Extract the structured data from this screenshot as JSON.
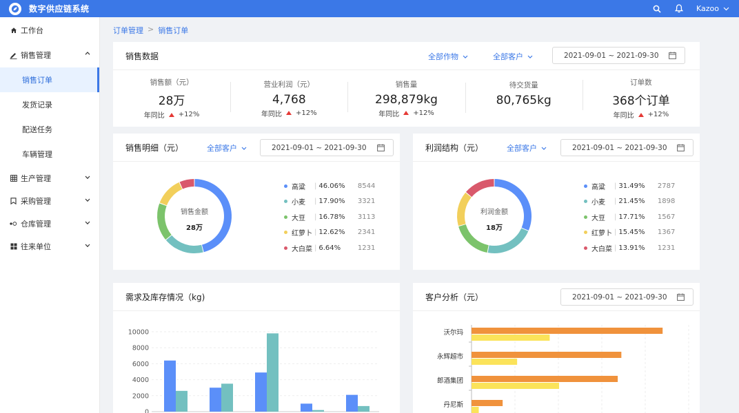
{
  "app": {
    "title": "数字供应链系统",
    "user": "Kazoo"
  },
  "sidebar": {
    "items": [
      {
        "label": "工作台",
        "icon": "home-icon"
      },
      {
        "label": "销售管理",
        "icon": "edit-icon",
        "expanded": true,
        "children": [
          "销售订单",
          "发货记录",
          "配送任务",
          "车辆管理"
        ],
        "active_child": "销售订单"
      },
      {
        "label": "生产管理",
        "icon": "grid-icon"
      },
      {
        "label": "采购管理",
        "icon": "bookmark-icon"
      },
      {
        "label": "仓库管理",
        "icon": "warehouse-icon"
      },
      {
        "label": "往来单位",
        "icon": "apps-icon"
      }
    ]
  },
  "breadcrumb": [
    "订单管理",
    "销售订单"
  ],
  "sales_data": {
    "title": "销售数据",
    "filter_crop": "全部作物",
    "filter_customer": "全部客户",
    "date_range": "2021-09-01 ~ 2021-09-30",
    "stats": [
      {
        "label": "销售额（元）",
        "value": "28万",
        "yoy_label": "年同比",
        "yoy": "+12%"
      },
      {
        "label": "营业利润（元）",
        "value": "4,768",
        "yoy_label": "年同比",
        "yoy": "+12%"
      },
      {
        "label": "销售量",
        "value": "298,879kg",
        "yoy_label": "年同比",
        "yoy": "+12%"
      },
      {
        "label": "待交货量",
        "value": "80,765kg"
      },
      {
        "label": "订单数",
        "value": "368个订单",
        "yoy_label": "年同比",
        "yoy": "+12%"
      }
    ]
  },
  "sales_detail": {
    "title": "销售明细（元）",
    "filter_customer": "全部客户",
    "date_range": "2021-09-01 ~ 2021-09-30",
    "center_label": "销售金额",
    "center_value": "28万"
  },
  "profit_structure": {
    "title": "利润结构（元）",
    "filter_customer": "全部客户",
    "date_range": "2021-09-01 ~ 2021-09-30",
    "center_label": "利润金额",
    "center_value": "18万"
  },
  "demand_inventory": {
    "title": "需求及库存情况（kg)"
  },
  "customer_analysis": {
    "title": "客户分析（元）",
    "date_range": "2021-09-01 ~ 2021-09-30"
  },
  "colors": {
    "accent": "#3b78e7",
    "blue": "#5b8ff9",
    "teal": "#73c0c0",
    "green": "#7cc36b",
    "yellow": "#f2cf5b",
    "red": "#d9596b",
    "orange": "#f0923c",
    "lightyellow": "#fbe35a"
  },
  "chart_data": [
    {
      "type": "pie",
      "id": "sales_detail",
      "labels": [
        "高粱",
        "小麦",
        "大豆",
        "红萝卜",
        "大白菜"
      ],
      "percents": [
        "46.06%",
        "17.90%",
        "16.78%",
        "12.62%",
        "6.64%"
      ],
      "values": [
        8544,
        3321,
        3113,
        2341,
        1231
      ],
      "colors": [
        "#5b8ff9",
        "#73c0c0",
        "#7cc36b",
        "#f2cf5b",
        "#d9596b"
      ]
    },
    {
      "type": "pie",
      "id": "profit_structure",
      "labels": [
        "高粱",
        "小麦",
        "大豆",
        "红萝卜",
        "大白菜"
      ],
      "percents": [
        "31.49%",
        "21.45%",
        "17.71%",
        "15.45%",
        "13.91%"
      ],
      "values": [
        2787,
        1898,
        1567,
        1367,
        1231
      ],
      "colors": [
        "#5b8ff9",
        "#73c0c0",
        "#7cc36b",
        "#f2cf5b",
        "#d9596b"
      ]
    },
    {
      "type": "bar",
      "id": "demand_inventory",
      "yticks": [
        0,
        2000,
        4000,
        6000,
        8000,
        10000
      ],
      "ylim": [
        0,
        10000
      ],
      "series": [
        {
          "values": [
            6400,
            3000,
            4900,
            1000,
            2100
          ],
          "color": "#5b8ff9"
        },
        {
          "values": [
            2600,
            3500,
            9800,
            200,
            700
          ],
          "color": "#73c0c0"
        }
      ]
    },
    {
      "type": "bar",
      "orientation": "horizontal",
      "id": "customer_analysis",
      "categories": [
        "沃尔玛",
        "永辉超市",
        "郎酒集团",
        "丹尼斯"
      ],
      "series": [
        {
          "values": [
            264,
            207,
            202,
            43
          ],
          "color": "#f0923c"
        },
        {
          "values": [
            108,
            63,
            121,
            10
          ],
          "color": "#fbe35a"
        }
      ]
    }
  ]
}
